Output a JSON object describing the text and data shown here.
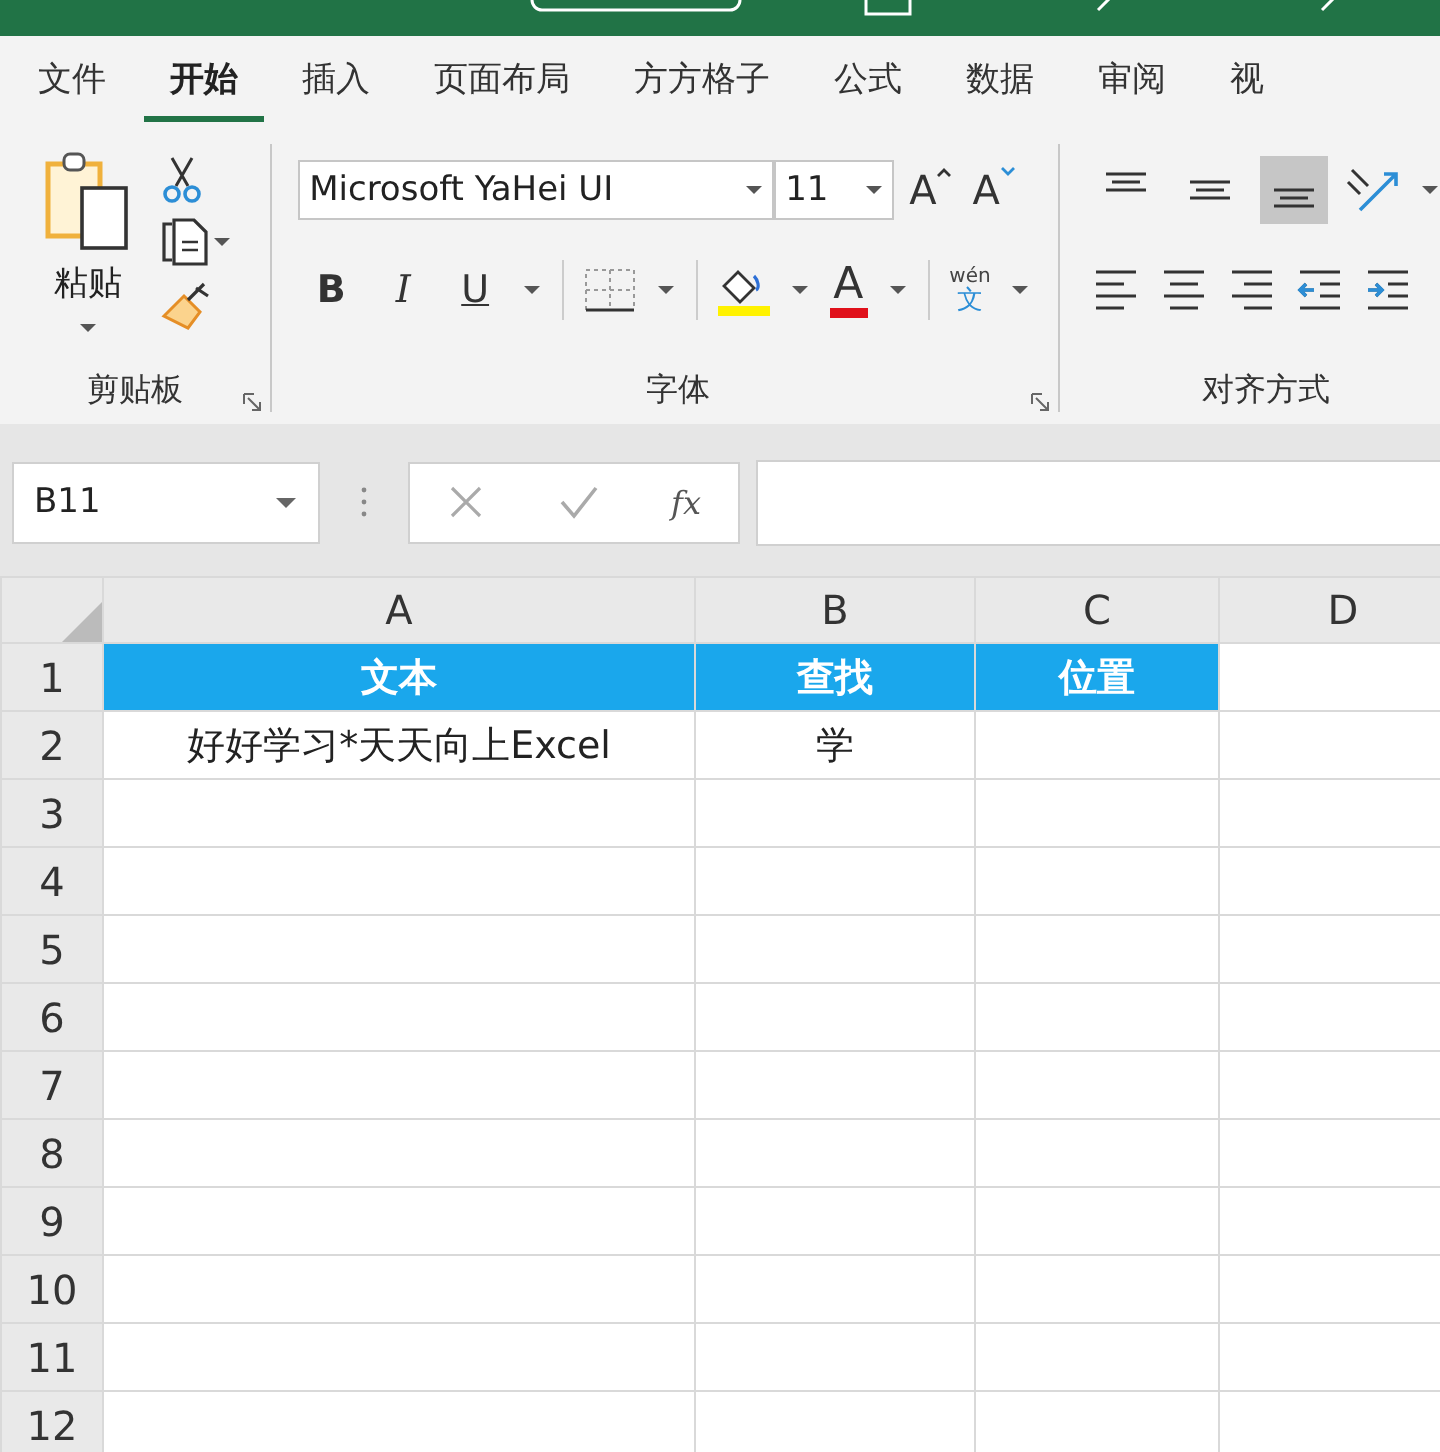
{
  "tabs": [
    {
      "label": "文件",
      "selected": false
    },
    {
      "label": "开始",
      "selected": true
    },
    {
      "label": "插入",
      "selected": false
    },
    {
      "label": "页面布局",
      "selected": false
    },
    {
      "label": "方方格子",
      "selected": false
    },
    {
      "label": "公式",
      "selected": false
    },
    {
      "label": "数据",
      "selected": false
    },
    {
      "label": "审阅",
      "selected": false
    },
    {
      "label": "视",
      "selected": false
    }
  ],
  "clipboard": {
    "paste_label": "粘贴",
    "group_label": "剪贴板"
  },
  "font": {
    "name": "Microsoft YaHei UI",
    "size": "11",
    "grow": "A",
    "shrink": "A",
    "styles": [
      {
        "kind": "bold",
        "label": "B"
      },
      {
        "kind": "italic",
        "label": "I"
      },
      {
        "kind": "underline",
        "label": "U"
      }
    ],
    "font_color": "A",
    "phonetic_top": "wén",
    "phonetic_bottom": "文",
    "group_label": "字体"
  },
  "alignment": {
    "group_label": "对齐方式",
    "vertical": [
      {
        "kind": "top",
        "selected": false
      },
      {
        "kind": "middle",
        "selected": false
      },
      {
        "kind": "bottom",
        "selected": true
      }
    ],
    "horizontal": [
      {
        "kind": "left"
      },
      {
        "kind": "center"
      },
      {
        "kind": "right"
      },
      {
        "kind": "outdent"
      },
      {
        "kind": "indent"
      }
    ]
  },
  "name_box": "B11",
  "function_label": "fx",
  "sheet": {
    "columns": [
      "A",
      "B",
      "C",
      "D"
    ],
    "rows": [
      {
        "number": "1",
        "kind": "header",
        "cells": [
          "文本",
          "查找",
          "位置"
        ]
      },
      {
        "number": "2",
        "kind": "data",
        "cells": [
          "好好学习*天天向上Excel",
          "学"
        ]
      },
      {
        "number": "3"
      },
      {
        "number": "4"
      },
      {
        "number": "5"
      },
      {
        "number": "6"
      },
      {
        "number": "7"
      },
      {
        "number": "8"
      },
      {
        "number": "9"
      },
      {
        "number": "10"
      },
      {
        "number": "11"
      },
      {
        "number": "12"
      }
    ]
  }
}
